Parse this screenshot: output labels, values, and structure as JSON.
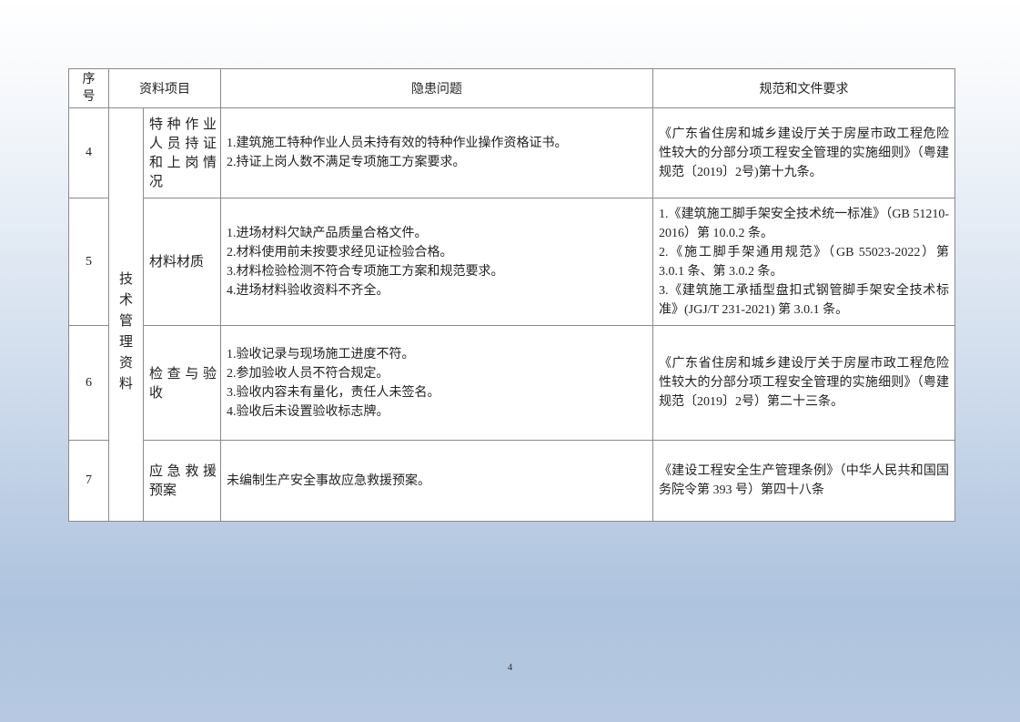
{
  "header": {
    "seq": "序号",
    "item": "资料项目",
    "issue": "隐患问题",
    "requirement": "规范和文件要求"
  },
  "category": "技术管理资料",
  "rows": [
    {
      "seq": "4",
      "item": "特种作业人员持证和上岗情况",
      "issues": [
        "1.建筑施工特种作业人员未持有效的特种作业操作资格证书。",
        "2.持证上岗人数不满足专项施工方案要求。"
      ],
      "requirements": [
        "《广东省住房和城乡建设厅关于房屋市政工程危险性较大的分部分项工程安全管理的实施细则》（粤建规范〔2019〕2号)第十九条。"
      ]
    },
    {
      "seq": "5",
      "item": "材料材质",
      "issues": [
        "1.进场材料欠缺产品质量合格文件。",
        "2.材料使用前未按要求经见证检验合格。",
        "3.材料检验检测不符合专项施工方案和规范要求。",
        "4.进场材料验收资料不齐全。"
      ],
      "requirements": [
        "1.《建筑施工脚手架安全技术统一标准》（GB 51210-2016）第 10.0.2 条。",
        "2.《施工脚手架通用规范》（GB 55023-2022）第 3.0.1 条、第 3.0.2 条。",
        "3.《建筑施工承插型盘扣式钢管脚手架安全技术标准》(JGJ/T 231-2021) 第 3.0.1 条。"
      ]
    },
    {
      "seq": "6",
      "item": "检查与验收",
      "issues": [
        "1.验收记录与现场施工进度不符。",
        "2.参加验收人员不符合规定。",
        "3.验收内容未有量化，责任人未签名。",
        "4.验收后未设置验收标志牌。"
      ],
      "requirements": [
        "《广东省住房和城乡建设厅关于房屋市政工程危险性较大的分部分项工程安全管理的实施细则》（粤建规范〔2019〕2号）第二十三条。"
      ]
    },
    {
      "seq": "7",
      "item": "应急救援预案",
      "issues": [
        "未编制生产安全事故应急救援预案。"
      ],
      "requirements": [
        "《建设工程安全生产管理条例》（中华人民共和国国务院令第 393 号）第四十八条"
      ]
    }
  ],
  "page_number": "4"
}
